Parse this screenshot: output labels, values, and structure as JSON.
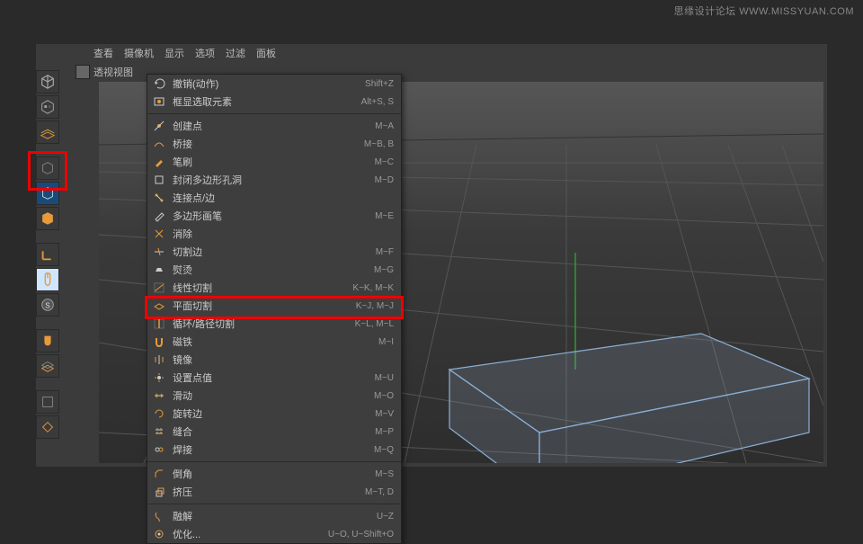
{
  "watermark": "思缘设计论坛  WWW.MISSYUAN.COM",
  "menubar": [
    "查看",
    "摄像机",
    "显示",
    "选项",
    "过滤",
    "面板"
  ],
  "viewport_label": "透视视图",
  "context_menu": {
    "groups": [
      [
        {
          "label": "撤销(动作)",
          "shortcut": "Shift+Z",
          "icon": "undo"
        },
        {
          "label": "框显选取元素",
          "shortcut": "Alt+S, S",
          "icon": "frame"
        }
      ],
      [
        {
          "label": "创建点",
          "shortcut": "M~A",
          "icon": "point"
        },
        {
          "label": "桥接",
          "shortcut": "M~B, B",
          "icon": "bridge"
        },
        {
          "label": "笔刷",
          "shortcut": "M~C",
          "icon": "brush"
        },
        {
          "label": "封闭多边形孔洞",
          "shortcut": "M~D",
          "icon": "close"
        },
        {
          "label": "连接点/边",
          "shortcut": "",
          "icon": "connect"
        },
        {
          "label": "多边形画笔",
          "shortcut": "M~E",
          "icon": "polypen"
        },
        {
          "label": "消除",
          "shortcut": "",
          "icon": "dissolve"
        },
        {
          "label": "切割边",
          "shortcut": "M~F",
          "icon": "cutedge"
        },
        {
          "label": "熨烫",
          "shortcut": "M~G",
          "icon": "iron"
        },
        {
          "label": "线性切割",
          "shortcut": "K~K, M~K",
          "icon": "line-cut"
        },
        {
          "label": "平面切割",
          "shortcut": "K~J, M~J",
          "icon": "plane-cut"
        },
        {
          "label": "循环/路径切割",
          "shortcut": "K~L, M~L",
          "icon": "loop-cut",
          "highlight": true
        },
        {
          "label": "磁铁",
          "shortcut": "M~I",
          "icon": "magnet"
        },
        {
          "label": "镜像",
          "shortcut": "",
          "icon": "mirror"
        },
        {
          "label": "设置点值",
          "shortcut": "M~U",
          "icon": "setpoint"
        },
        {
          "label": "滑动",
          "shortcut": "M~O",
          "icon": "slide"
        },
        {
          "label": "旋转边",
          "shortcut": "M~V",
          "icon": "rotate"
        },
        {
          "label": "缝合",
          "shortcut": "M~P",
          "icon": "stitch"
        },
        {
          "label": "焊接",
          "shortcut": "M~Q",
          "icon": "weld"
        }
      ],
      [
        {
          "label": "倒角",
          "shortcut": "M~S",
          "icon": "bevel"
        },
        {
          "label": "挤压",
          "shortcut": "M~T, D",
          "icon": "extrude"
        }
      ],
      [
        {
          "label": "融解",
          "shortcut": "U~Z",
          "icon": "melt"
        },
        {
          "label": "优化...",
          "shortcut": "U~O, U~Shift+O",
          "icon": "optimize"
        }
      ]
    ]
  }
}
